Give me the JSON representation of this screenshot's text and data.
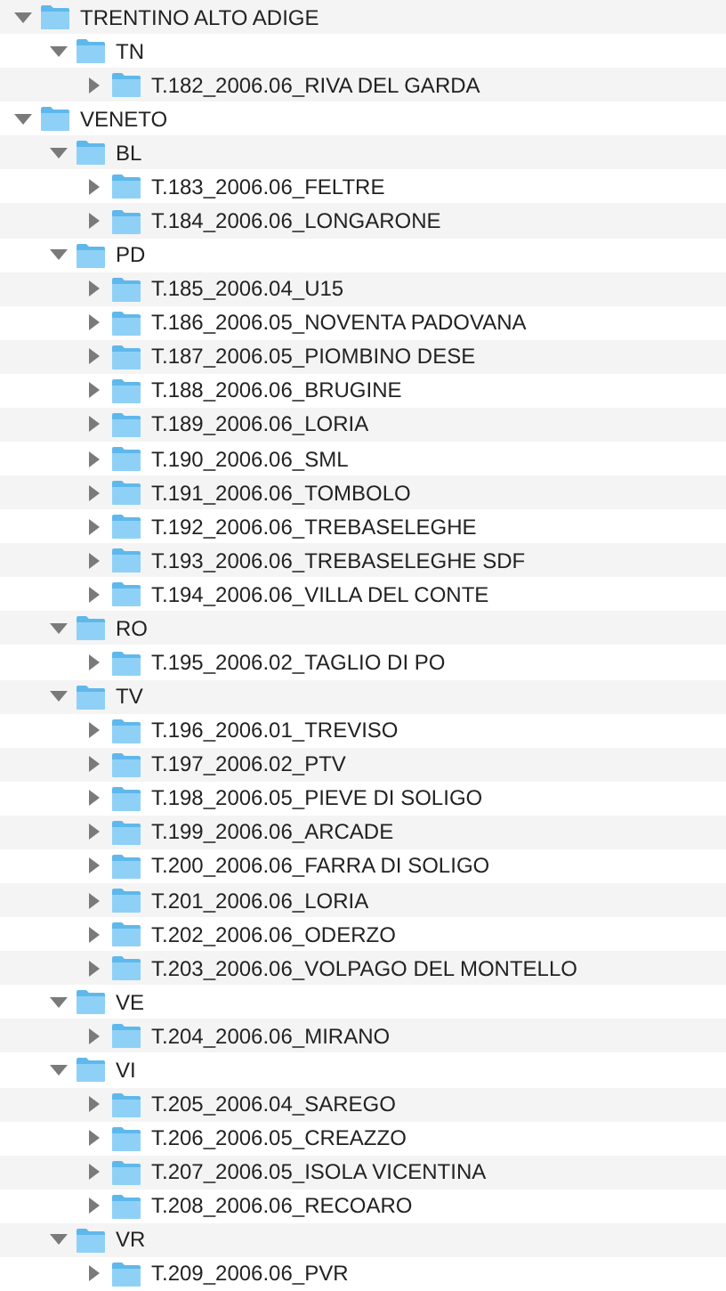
{
  "tree": [
    {
      "label": "TRENTINO ALTO ADIGE",
      "expanded": true,
      "children": [
        {
          "label": "TN",
          "expanded": true,
          "children": [
            {
              "label": "T.182_2006.06_RIVA DEL GARDA",
              "expanded": false
            }
          ]
        }
      ]
    },
    {
      "label": "VENETO",
      "expanded": true,
      "children": [
        {
          "label": "BL",
          "expanded": true,
          "children": [
            {
              "label": "T.183_2006.06_FELTRE",
              "expanded": false
            },
            {
              "label": "T.184_2006.06_LONGARONE",
              "expanded": false
            }
          ]
        },
        {
          "label": "PD",
          "expanded": true,
          "children": [
            {
              "label": "T.185_2006.04_U15",
              "expanded": false
            },
            {
              "label": "T.186_2006.05_NOVENTA PADOVANA",
              "expanded": false
            },
            {
              "label": "T.187_2006.05_PIOMBINO DESE",
              "expanded": false
            },
            {
              "label": "T.188_2006.06_BRUGINE",
              "expanded": false
            },
            {
              "label": "T.189_2006.06_LORIA",
              "expanded": false
            },
            {
              "label": "T.190_2006.06_SML",
              "expanded": false
            },
            {
              "label": "T.191_2006.06_TOMBOLO",
              "expanded": false
            },
            {
              "label": "T.192_2006.06_TREBASELEGHE",
              "expanded": false
            },
            {
              "label": "T.193_2006.06_TREBASELEGHE SDF",
              "expanded": false
            },
            {
              "label": "T.194_2006.06_VILLA DEL CONTE",
              "expanded": false
            }
          ]
        },
        {
          "label": "RO",
          "expanded": true,
          "children": [
            {
              "label": "T.195_2006.02_TAGLIO DI PO",
              "expanded": false
            }
          ]
        },
        {
          "label": "TV",
          "expanded": true,
          "children": [
            {
              "label": "T.196_2006.01_TREVISO",
              "expanded": false
            },
            {
              "label": "T.197_2006.02_PTV",
              "expanded": false
            },
            {
              "label": "T.198_2006.05_PIEVE DI SOLIGO",
              "expanded": false
            },
            {
              "label": "T.199_2006.06_ARCADE",
              "expanded": false
            },
            {
              "label": "T.200_2006.06_FARRA DI SOLIGO",
              "expanded": false
            },
            {
              "label": "T.201_2006.06_LORIA",
              "expanded": false
            },
            {
              "label": "T.202_2006.06_ODERZO",
              "expanded": false
            },
            {
              "label": "T.203_2006.06_VOLPAGO DEL MONTELLO",
              "expanded": false
            }
          ]
        },
        {
          "label": "VE",
          "expanded": true,
          "children": [
            {
              "label": "T.204_2006.06_MIRANO",
              "expanded": false
            }
          ]
        },
        {
          "label": "VI",
          "expanded": true,
          "children": [
            {
              "label": "T.205_2006.04_SAREGO",
              "expanded": false
            },
            {
              "label": "T.206_2006.05_CREAZZO",
              "expanded": false
            },
            {
              "label": "T.207_2006.05_ISOLA VICENTINA",
              "expanded": false
            },
            {
              "label": "T.208_2006.06_RECOARO",
              "expanded": false
            }
          ]
        },
        {
          "label": "VR",
          "expanded": true,
          "children": [
            {
              "label": "T.209_2006.06_PVR",
              "expanded": false
            }
          ]
        }
      ]
    }
  ]
}
